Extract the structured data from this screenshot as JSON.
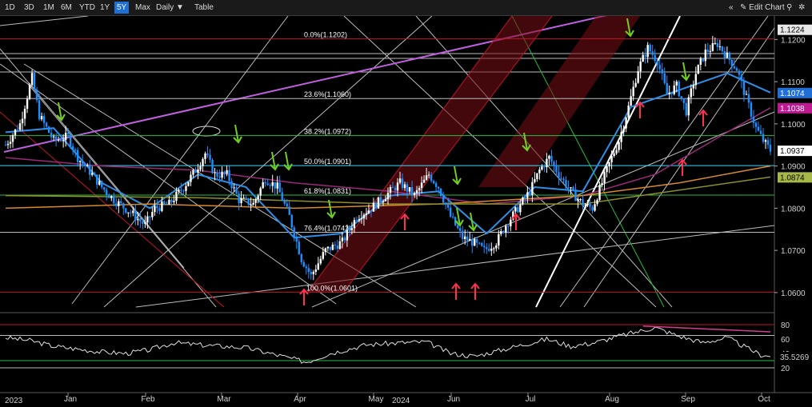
{
  "toolbar": {
    "ranges": [
      "1D",
      "3D",
      "1M",
      "6M",
      "YTD",
      "1Y",
      "5Y",
      "Max"
    ],
    "active_range": "5Y",
    "interval": "Daily",
    "table_label": "Table",
    "edit_label": "Edit Chart"
  },
  "colors": {
    "candle_up": "#ffffff",
    "candle_down": "#1e8fff",
    "ma_fast": "#2f8fe8",
    "ma_mid": "#9a2a78",
    "ma_slow": "#d98a2a",
    "ma_long": "#8f8f2a",
    "fib": [
      "#c0142c",
      "#bbbbbb",
      "#22c040",
      "#40d8ff",
      "#22c040",
      "#bbbbbb",
      "#c0142c"
    ],
    "channel_fill": "#7a0f14",
    "magenta": "#c060e0",
    "up_arrow": "#ff3050",
    "down_arrow": "#70d020"
  },
  "chart_data": [
    {
      "type": "candlestick",
      "ylim": [
        1.056,
        1.125
      ],
      "y_ticks": [
        1.06,
        1.07,
        1.08,
        1.09,
        1.1,
        1.11,
        1.12
      ],
      "y_tick_labels": [
        "1.0600",
        "1.0700",
        "1.0800",
        "1.0900",
        "1.1000",
        "1.1100",
        "1.1200"
      ],
      "x_ticks": [
        "Jan",
        "Feb",
        "Mar",
        "Apr",
        "May",
        "Jun",
        "Jul",
        "Aug",
        "Sep",
        "Oct"
      ],
      "year_labels": [
        "2023",
        "2024"
      ],
      "price_tags": [
        {
          "label": "1.1224",
          "value": 1.1224,
          "bg": "#e8e8e8",
          "fg": "#000000"
        },
        {
          "label": "1.1074",
          "value": 1.1074,
          "bg": "#1f6fd6",
          "fg": "#ffffff"
        },
        {
          "label": "1.1038",
          "value": 1.1038,
          "bg": "#c01890",
          "fg": "#ffffff"
        },
        {
          "label": "1.0937",
          "value": 1.0937,
          "bg": "#ffffff",
          "fg": "#000000"
        },
        {
          "label": "1.0874",
          "value": 1.0874,
          "bg": "#a8b848",
          "fg": "#000000"
        }
      ],
      "fib_levels": [
        {
          "label": "0.0%(1.1202)",
          "value": 1.1202
        },
        {
          "label": "23.6%(1.1060)",
          "value": 1.106
        },
        {
          "label": "38.2%(1.0972)",
          "value": 1.0972
        },
        {
          "label": "50.0%(1.0901)",
          "value": 1.0901
        },
        {
          "label": "61.8%(1.0831)",
          "value": 1.0831
        },
        {
          "label": "76.4%(1.0743)",
          "value": 1.0743
        },
        {
          "label": "100.0%(1.0601)",
          "value": 1.0601
        }
      ],
      "anchors": [
        [
          0,
          1.095
        ],
        [
          6,
          1.1
        ],
        [
          11,
          1.111
        ],
        [
          14,
          1.102
        ],
        [
          20,
          1.096
        ],
        [
          26,
          1.097
        ],
        [
          30,
          1.092
        ],
        [
          36,
          1.088
        ],
        [
          40,
          1.085
        ],
        [
          45,
          1.082
        ],
        [
          52,
          1.079
        ],
        [
          58,
          1.076
        ],
        [
          62,
          1.08
        ],
        [
          68,
          1.081
        ],
        [
          74,
          1.085
        ],
        [
          79,
          1.089
        ],
        [
          83,
          1.093
        ],
        [
          87,
          1.088
        ],
        [
          92,
          1.088
        ],
        [
          97,
          1.082
        ],
        [
          103,
          1.081
        ],
        [
          108,
          1.087
        ],
        [
          113,
          1.085
        ],
        [
          118,
          1.078
        ],
        [
          123,
          1.068
        ],
        [
          127,
          1.064
        ],
        [
          133,
          1.07
        ],
        [
          140,
          1.072
        ],
        [
          146,
          1.078
        ],
        [
          152,
          1.08
        ],
        [
          158,
          1.083
        ],
        [
          164,
          1.086
        ],
        [
          170,
          1.083
        ],
        [
          176,
          1.088
        ],
        [
          180,
          1.085
        ],
        [
          185,
          1.078
        ],
        [
          190,
          1.073
        ],
        [
          194,
          1.072
        ],
        [
          199,
          1.07
        ],
        [
          204,
          1.072
        ],
        [
          208,
          1.076
        ],
        [
          213,
          1.08
        ],
        [
          218,
          1.084
        ],
        [
          222,
          1.089
        ],
        [
          226,
          1.092
        ],
        [
          230,
          1.088
        ],
        [
          235,
          1.084
        ],
        [
          240,
          1.081
        ],
        [
          244,
          1.08
        ],
        [
          248,
          1.086
        ],
        [
          252,
          1.092
        ],
        [
          255,
          1.096
        ],
        [
          259,
          1.104
        ],
        [
          263,
          1.113
        ],
        [
          267,
          1.118
        ],
        [
          271,
          1.115
        ],
        [
          275,
          1.107
        ],
        [
          279,
          1.109
        ],
        [
          283,
          1.103
        ],
        [
          287,
          1.112
        ],
        [
          291,
          1.117
        ],
        [
          296,
          1.119
        ],
        [
          300,
          1.116
        ],
        [
          304,
          1.113
        ],
        [
          308,
          1.106
        ],
        [
          312,
          1.099
        ],
        [
          315,
          1.096
        ],
        [
          318,
          1.0937
        ]
      ],
      "overlay_lines": [
        {
          "name": "ma_fast",
          "values": [
            [
              0,
              1.098
            ],
            [
              20,
              1.099
            ],
            [
              40,
              1.086
            ],
            [
              60,
              1.08
            ],
            [
              80,
              1.088
            ],
            [
              100,
              1.085
            ],
            [
              120,
              1.073
            ],
            [
              140,
              1.074
            ],
            [
              160,
              1.083
            ],
            [
              180,
              1.084
            ],
            [
              200,
              1.074
            ],
            [
              220,
              1.085
            ],
            [
              240,
              1.084
            ],
            [
              260,
              1.104
            ],
            [
              280,
              1.108
            ],
            [
              300,
              1.112
            ],
            [
              318,
              1.1074
            ]
          ]
        },
        {
          "name": "ma_mid",
          "values": [
            [
              0,
              1.092
            ],
            [
              40,
              1.09
            ],
            [
              80,
              1.089
            ],
            [
              120,
              1.086
            ],
            [
              160,
              1.084
            ],
            [
              200,
              1.081
            ],
            [
              240,
              1.083
            ],
            [
              270,
              1.088
            ],
            [
              300,
              1.098
            ],
            [
              318,
              1.1038
            ]
          ]
        },
        {
          "name": "ma_slow",
          "values": [
            [
              0,
              1.08
            ],
            [
              60,
              1.081
            ],
            [
              120,
              1.08
            ],
            [
              180,
              1.081
            ],
            [
              240,
              1.083
            ],
            [
              280,
              1.086
            ],
            [
              318,
              1.09
            ]
          ]
        },
        {
          "name": "ma_long",
          "values": [
            [
              0,
              1.083
            ],
            [
              80,
              1.0825
            ],
            [
              160,
              1.081
            ],
            [
              240,
              1.081
            ],
            [
              318,
              1.0874
            ]
          ]
        }
      ]
    },
    {
      "type": "line",
      "name": "rsi",
      "ylim": [
        10,
        90
      ],
      "y_ticks": [
        20,
        40,
        60,
        80
      ],
      "y_tick_labels": [
        "20",
        "40",
        "60",
        "80"
      ],
      "last_label": "35.5269",
      "values": [
        [
          0,
          62
        ],
        [
          10,
          58
        ],
        [
          20,
          50
        ],
        [
          30,
          46
        ],
        [
          40,
          42
        ],
        [
          50,
          40
        ],
        [
          60,
          45
        ],
        [
          70,
          55
        ],
        [
          80,
          52
        ],
        [
          90,
          50
        ],
        [
          100,
          48
        ],
        [
          110,
          40
        ],
        [
          120,
          32
        ],
        [
          125,
          28
        ],
        [
          135,
          40
        ],
        [
          150,
          52
        ],
        [
          165,
          55
        ],
        [
          175,
          56
        ],
        [
          185,
          40
        ],
        [
          195,
          36
        ],
        [
          205,
          44
        ],
        [
          215,
          52
        ],
        [
          225,
          60
        ],
        [
          235,
          50
        ],
        [
          245,
          55
        ],
        [
          255,
          64
        ],
        [
          265,
          72
        ],
        [
          270,
          76
        ],
        [
          280,
          64
        ],
        [
          290,
          55
        ],
        [
          300,
          62
        ],
        [
          308,
          48
        ],
        [
          314,
          38
        ],
        [
          318,
          35.5
        ]
      ]
    }
  ]
}
